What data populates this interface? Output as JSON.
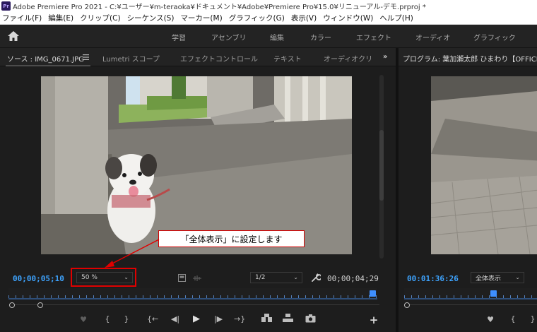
{
  "titlebar": {
    "title": "Adobe Premiere Pro 2021 - C:¥ユーザー¥m-teraoka¥ドキュメント¥Adobe¥Premiere Pro¥15.0¥リニューアル-デモ.prproj *"
  },
  "menubar": {
    "items": [
      "ファイル(F)",
      "編集(E)",
      "クリップ(C)",
      "シーケンス(S)",
      "マーカー(M)",
      "グラフィック(G)",
      "表示(V)",
      "ウィンドウ(W)",
      "ヘルプ(H)"
    ]
  },
  "workspace": {
    "tabs": [
      "学習",
      "アセンブリ",
      "編集",
      "カラー",
      "エフェクト",
      "オーディオ",
      "グラフィック"
    ]
  },
  "source_tabs": {
    "items": [
      "ソース : IMG_0671.JPG",
      "Lumetri スコープ",
      "エフェクトコントロール",
      "テキスト",
      "オーディオクリ"
    ],
    "overflow": "»"
  },
  "program_tabs": {
    "title": "プログラム: 葉加瀬太郎 ひまわり【OFFICIAL】"
  },
  "source": {
    "timecode_in": "00;00;05;10",
    "zoom_value": "50 %",
    "resolution": "1/2",
    "timecode_duration": "00;00;04;29",
    "callout": "「全体表示」に設定します"
  },
  "program": {
    "timecode": "00:01:36:26",
    "zoom_value": "全体表示"
  },
  "transport_icons": [
    "marker-icon",
    "mark-in-icon",
    "mark-out-icon",
    "go-to-in-icon",
    "step-back-icon",
    "play-icon",
    "step-forward-icon",
    "go-to-out-icon",
    "insert-icon",
    "overwrite-icon",
    "export-frame-icon",
    "add-button-icon"
  ],
  "colors": {
    "timecode_blue": "#3ea4ff",
    "highlight_red": "#e00000",
    "panel_bg": "#1d1d1d"
  }
}
